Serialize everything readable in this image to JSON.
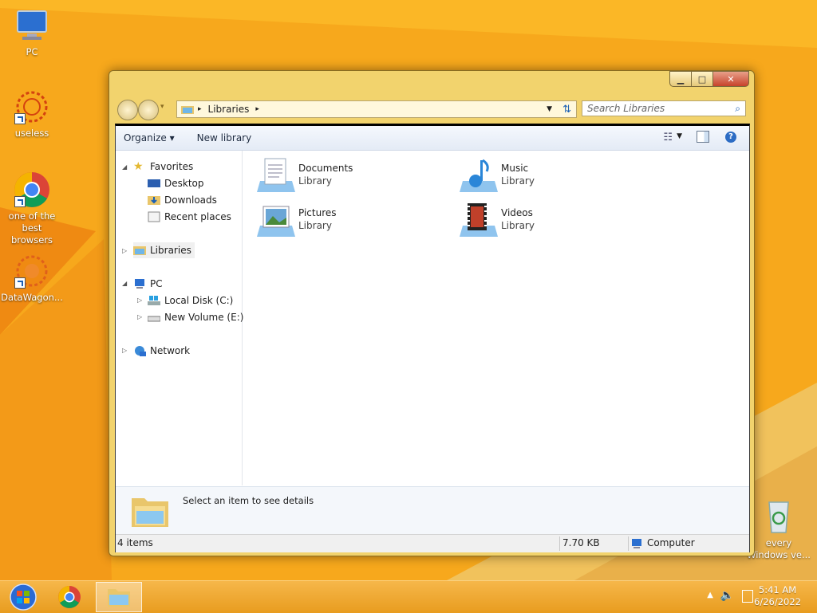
{
  "desktop": {
    "icons": [
      {
        "label": "PC"
      },
      {
        "label": "useless"
      },
      {
        "label": "one of the best browsers"
      },
      {
        "label": "DataWagon..."
      },
      {
        "label": "every Windows ve..."
      }
    ]
  },
  "window": {
    "breadcrumb": "Libraries",
    "search_placeholder": "Search Libraries",
    "toolbar": {
      "organize": "Organize",
      "new_library": "New library"
    },
    "nav": {
      "favorites": "Favorites",
      "desktop": "Desktop",
      "downloads": "Downloads",
      "recent": "Recent places",
      "libraries": "Libraries",
      "pc": "PC",
      "local_disk": "Local Disk (C:)",
      "new_volume": "New Volume (E:)",
      "network": "Network"
    },
    "libraries": [
      {
        "name": "Documents",
        "type": "Library"
      },
      {
        "name": "Music",
        "type": "Library"
      },
      {
        "name": "Pictures",
        "type": "Library"
      },
      {
        "name": "Videos",
        "type": "Library"
      }
    ],
    "details_text": "Select an item to see details",
    "status": {
      "items": "4 items",
      "size": "7.70 KB",
      "location": "Computer"
    }
  },
  "taskbar": {
    "time": "5:41 AM",
    "date": "6/26/2022"
  },
  "colors": {
    "desktop": "#f7a81c",
    "window_frame": "#f2d36d",
    "accent": "#1a5fb4"
  }
}
